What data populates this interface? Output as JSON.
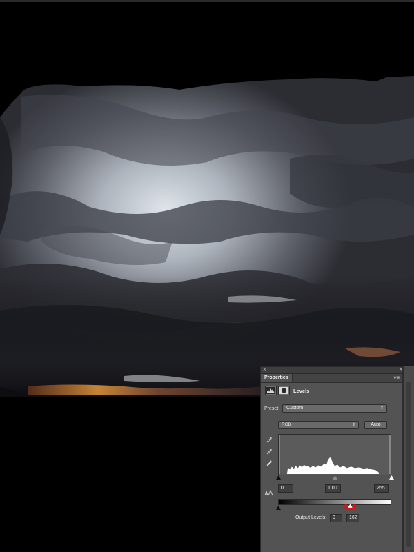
{
  "panel": {
    "close_glyph": "×",
    "collapse_glyph": "‹‹",
    "tab_label": "Properties",
    "menu_glyph": "▾≡",
    "layer_title": "Levels",
    "preset_label": "Preset:",
    "preset_value": "Custom",
    "channel_value": "RGB",
    "auto_label": "Auto",
    "input_black": "0",
    "input_gamma": "1.00",
    "input_white": "255",
    "output_label": "Output Levels:",
    "output_black": "0",
    "output_white": "162",
    "select_arrow": "⇕",
    "icons": [
      "close-icon",
      "collapse-icon",
      "panel-menu-icon",
      "levels-adjustment-icon",
      "layer-mask-icon",
      "black-point-eyedropper-icon",
      "gray-point-eyedropper-icon",
      "white-point-eyedropper-icon",
      "clipping-warning-icon"
    ]
  },
  "colors": {
    "panel_bg": "#535353",
    "annotation_red": "#e01010"
  },
  "output_levels": {
    "black": 0,
    "white": 162,
    "max": 255
  },
  "input_levels": {
    "black": 0,
    "gamma": 1.0,
    "white": 255
  }
}
